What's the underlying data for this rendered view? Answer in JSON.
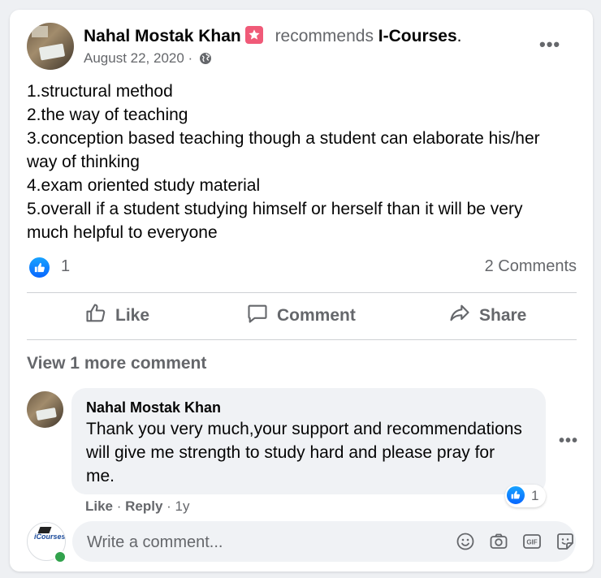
{
  "post": {
    "author": "Nahal Mostak Khan",
    "recommends_text": "recommends",
    "page_name": "I-Courses",
    "page_suffix": ".",
    "date": "August 22, 2020 ·",
    "body_lines": [
      "1.structural method",
      "2.the way of teaching",
      "3.conception based teaching though a student can elaborate his/her",
      "way of thinking",
      "4.exam oriented study material",
      "5.overall if a student studying himself or herself than it will be very",
      "much helpful to everyone"
    ],
    "reaction_count": "1",
    "comments_count": "2 Comments"
  },
  "actions": {
    "like": "Like",
    "comment": "Comment",
    "share": "Share"
  },
  "view_more": "View 1 more comment",
  "comment": {
    "author": "Nahal Mostak Khan",
    "text": "Thank you very much,your support and recommendations will give me strength to study hard and please pray for me.",
    "reaction_count": "1",
    "like_label": "Like",
    "separator": " · ",
    "reply_label": "Reply",
    "time": "1y"
  },
  "composer": {
    "placeholder": "Write a comment...",
    "avatar_logo_text": "iCourses"
  },
  "icons": {
    "header_badge": "star-badge-icon",
    "audience": "globe-icon",
    "more": "more-options-icon",
    "reaction": "like-reaction-icon",
    "like": "thumbs-up-icon",
    "comment": "comment-bubble-icon",
    "share": "share-arrow-icon",
    "emoji": "emoji-icon",
    "camera": "camera-icon",
    "gif": "gif-icon",
    "sticker": "sticker-icon"
  },
  "colors": {
    "accent": "#0866ff",
    "secondary_text": "#65676b",
    "badge": "#f05a78",
    "online": "#31a24c"
  }
}
